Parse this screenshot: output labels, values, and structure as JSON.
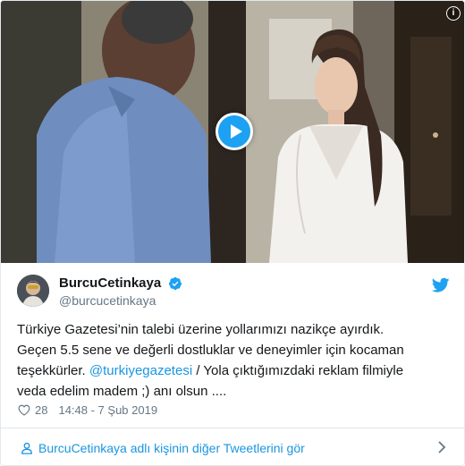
{
  "tweet": {
    "author": {
      "display_name": "BurcuCetinkaya",
      "handle": "@burcucetinkaya",
      "verified": true
    },
    "text_parts": {
      "line1": "Türkiye Gazetesi’nin talebi üzerine yollarımızı nazikçe ayırdık.",
      "line2": "Geçen 5.5 sene ve değerli dostluklar ve deneyimler için kocaman",
      "line3_pre": "teşekkürler. ",
      "mention": "@turkiyegazetesi",
      "line3_post": " / Yola çıktığımızdaki reklam filmiyle",
      "line4": "veda edelim madem ;) anı olsun ...."
    },
    "likes": "28",
    "timestamp": "14:48 - 7 Şub 2019",
    "footer_link": "BurcuCetinkaya adlı kişinin diğer Tweetlerini gör"
  },
  "icons": {
    "play": "play-icon",
    "info": "info-icon",
    "verified": "verified-badge-icon",
    "logo": "twitter-bird-icon",
    "like": "heart-icon",
    "profile": "person-icon",
    "chevron": "chevron-right-icon"
  },
  "colors": {
    "accent": "#1da1f2",
    "link": "#1b95e0",
    "text": "#14171a",
    "secondary": "#657786",
    "border": "#e1e8ed"
  }
}
